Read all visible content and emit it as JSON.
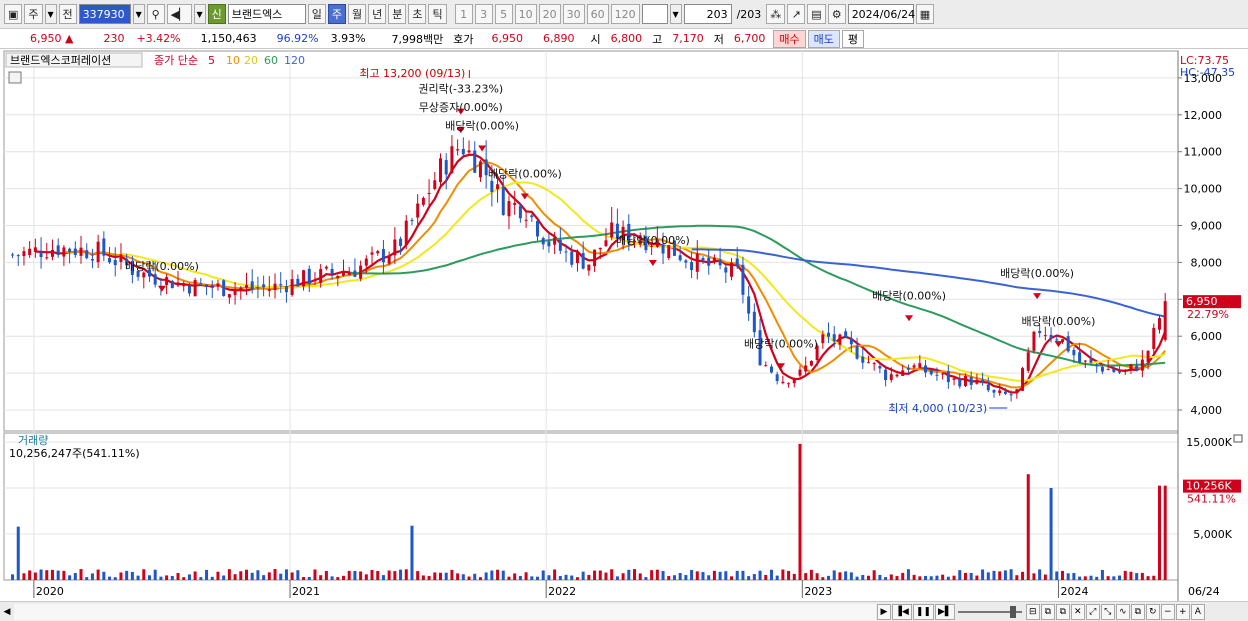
{
  "toolbar": {
    "period_mode": "주",
    "prev_label": "전",
    "stock_code": "337930",
    "stock_name": "브랜드엑스",
    "new_badge": "신",
    "periods": [
      "일",
      "주",
      "월",
      "년",
      "분",
      "초",
      "틱"
    ],
    "active_period": "주",
    "intervals": [
      "1",
      "3",
      "5",
      "10",
      "20",
      "30",
      "60",
      "120"
    ],
    "count": "203",
    "count_total": "/203",
    "date": "2024/06/24"
  },
  "quote": {
    "price": "6,950",
    "change": "230",
    "change_pct": "+3.42%",
    "volume": "1,150,463",
    "vol_ratio": "96.92%",
    "turnover": "3.93%",
    "amount": "7,998백만",
    "ask_label": "호가",
    "ask": "6,950",
    "bid": "6,890",
    "open_label": "시",
    "open": "6,800",
    "high_label": "고",
    "high": "7,170",
    "low_label": "저",
    "low": "6,700",
    "buy_label": "매수",
    "sell_label": "매도",
    "eval_label": "평"
  },
  "legend": {
    "stock_name": "브랜드엑스코퍼레이션",
    "ma_label": "종가 단순",
    "ma_periods": [
      "5",
      "10",
      "20",
      "60",
      "120"
    ],
    "volume_label": "거래량",
    "volume_value": "10,256,247주(541.11%)"
  },
  "colors": {
    "up": "#d0021b",
    "down": "#1f56c8",
    "ma5": "#d0021b",
    "ma10": "#f08c00",
    "ma20": "#f2e81c",
    "ma60": "#2e9a5c",
    "ma120": "#3a63d8",
    "grid": "#e4e4e4"
  },
  "chart_data": {
    "type": "candlestick",
    "y_axis": {
      "price_ticks": [
        4000,
        5000,
        6000,
        7000,
        8000,
        9000,
        10000,
        11000,
        12000,
        13000
      ],
      "price_tick_labels": [
        "4,000",
        "5,000",
        "6,000",
        "7,000",
        "8,000",
        "9,000",
        "10,000",
        "11,000",
        "12,000",
        "13,000"
      ],
      "volume_ticks": [
        5000000,
        10000000,
        15000000
      ],
      "volume_tick_labels": [
        "5,000K",
        "10,000K",
        "15,000K"
      ]
    },
    "x_axis": {
      "year_labels": [
        {
          "label": "2020",
          "date": "2020-01"
        },
        {
          "label": "2021",
          "date": "2021-01"
        },
        {
          "label": "2022",
          "date": "2022-01"
        },
        {
          "label": "2023",
          "date": "2023-01"
        },
        {
          "label": "2024",
          "date": "2024-01"
        }
      ],
      "end_label": "06/24"
    },
    "right_labels": {
      "lc": "LC:73.75",
      "hc": "HC:-47.35",
      "last_price": "6,950",
      "last_pct": "22.79%",
      "last_volume": "10,256K",
      "last_volume_pct": "541.11%"
    },
    "annotations": {
      "high": {
        "text": "최고 13,200 (09/13)",
        "price": 13200,
        "date": "2021-09-13"
      },
      "low": {
        "text": "최저 4,000 (10/23)",
        "price": 4000,
        "date": "2023-10-23"
      },
      "events": [
        {
          "text": "배당락(0.00%)",
          "date": "2020-07",
          "price": 7800
        },
        {
          "text": "권리락(-33.23%)",
          "date": "2021-09",
          "price": 12600
        },
        {
          "text": "무상증자(0.00%)",
          "date": "2021-09",
          "price": 12100
        },
        {
          "text": "배당락(0.00%)",
          "date": "2021-10",
          "price": 11600
        },
        {
          "text": "배당락(0.00%)",
          "date": "2021-12",
          "price": 10300
        },
        {
          "text": "배당락(0.00%)",
          "date": "2022-06",
          "price": 8500
        },
        {
          "text": "배당락(0.00%)",
          "date": "2022-12",
          "price": 5700
        },
        {
          "text": "배당락(0.00%)",
          "date": "2023-06",
          "price": 7000
        },
        {
          "text": "배당락(0.00%)",
          "date": "2023-12",
          "price": 7600
        },
        {
          "text": "배당락(0.00%)",
          "date": "2024-01",
          "price": 6300
        }
      ]
    },
    "price_path_monthly": [
      [
        "2019-12",
        8200
      ],
      [
        "2020-02",
        8400
      ],
      [
        "2020-04",
        8300
      ],
      [
        "2020-06",
        7700
      ],
      [
        "2020-08",
        7400
      ],
      [
        "2020-10",
        7300
      ],
      [
        "2020-12",
        7300
      ],
      [
        "2021-02",
        7600
      ],
      [
        "2021-04",
        7800
      ],
      [
        "2021-06",
        8400
      ],
      [
        "2021-07",
        9400
      ],
      [
        "2021-08",
        10500
      ],
      [
        "2021-09",
        11200
      ],
      [
        "2021-10",
        10600
      ],
      [
        "2021-11",
        9600
      ],
      [
        "2021-12",
        9500
      ],
      [
        "2022-01",
        8600
      ],
      [
        "2022-02",
        8200
      ],
      [
        "2022-03",
        8000
      ],
      [
        "2022-04",
        8800
      ],
      [
        "2022-06",
        8600
      ],
      [
        "2022-08",
        8000
      ],
      [
        "2022-10",
        7700
      ],
      [
        "2022-11",
        5400
      ],
      [
        "2022-12",
        4800
      ],
      [
        "2023-01",
        5000
      ],
      [
        "2023-02",
        6000
      ],
      [
        "2023-03",
        5800
      ],
      [
        "2023-05",
        4900
      ],
      [
        "2023-06",
        5200
      ],
      [
        "2023-07",
        5000
      ],
      [
        "2023-08",
        4800
      ],
      [
        "2023-09",
        4800
      ],
      [
        "2023-10",
        4400
      ],
      [
        "2023-11",
        4400
      ],
      [
        "2023-12",
        6200
      ],
      [
        "2024-01",
        6000
      ],
      [
        "2024-02",
        5300
      ],
      [
        "2024-04",
        5000
      ],
      [
        "2024-05",
        5300
      ],
      [
        "2024-06",
        6950
      ]
    ],
    "volume_peaks": [
      {
        "date": "2019-12",
        "value": 5800000
      },
      {
        "date": "2021-07",
        "value": 5900000
      },
      {
        "date": "2023-01",
        "value": 14800000
      },
      {
        "date": "2023-01",
        "value": 6300000
      },
      {
        "date": "2023-12",
        "value": 11500000
      },
      {
        "date": "2024-01",
        "value": 10000000
      },
      {
        "date": "2024-06",
        "value": 10256247
      }
    ]
  }
}
